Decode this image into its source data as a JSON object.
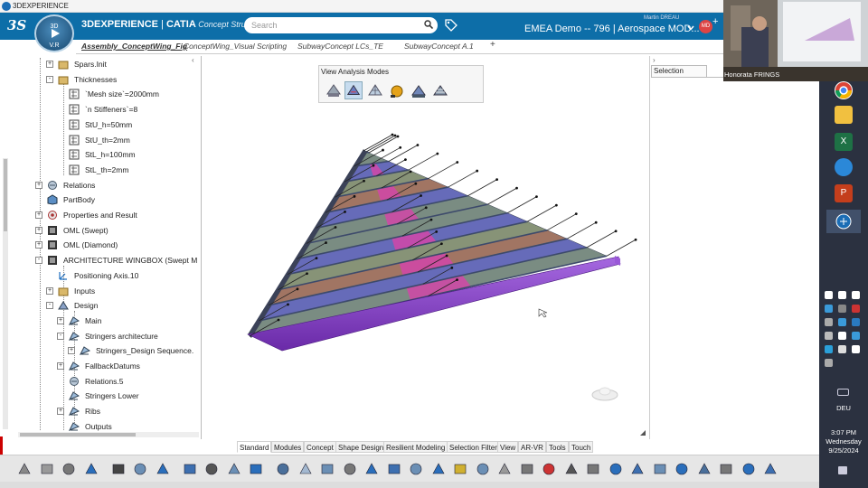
{
  "window": {
    "title": "3DEXPERIENCE"
  },
  "header": {
    "logo": "3S",
    "compass_top": "3D",
    "compass_version": "V.R",
    "app_brand": "3DEXPERIENCE",
    "app_sep": " | ",
    "app_name": "CATIA",
    "app_role": " Concept Struct...",
    "search_placeholder": "Search",
    "user_name": "Martin DREAU",
    "tenant": "EMEA Demo -- 796 | Aerospace MOD...",
    "avatar_initials": "MD"
  },
  "tabs": [
    {
      "label": "Assembly_ConceptWing_Fig",
      "active": true
    },
    {
      "label": "ConceptWing_Visual Scripting",
      "active": false
    },
    {
      "label": "SubwayConcept LCs_TE",
      "active": false
    },
    {
      "label": "SubwayConcept A.1",
      "active": false
    }
  ],
  "tree": [
    {
      "label": "Spars.Init",
      "expander": "+"
    },
    {
      "label": "Thicknesses",
      "expander": "-"
    },
    {
      "label": "`Mesh size`=2000mm",
      "expander": ""
    },
    {
      "label": "`n Stiffeners`=8",
      "expander": ""
    },
    {
      "label": "StU_h=50mm",
      "expander": ""
    },
    {
      "label": "StU_th=2mm",
      "expander": ""
    },
    {
      "label": "StL_h=100mm",
      "expander": ""
    },
    {
      "label": "StL_th=2mm",
      "expander": ""
    },
    {
      "label": "Relations",
      "expander": "+"
    },
    {
      "label": "PartBody",
      "expander": ""
    },
    {
      "label": "Properties and Result",
      "expander": "+"
    },
    {
      "label": "OML (Swept)",
      "expander": "+"
    },
    {
      "label": "OML (Diamond)",
      "expander": "+"
    },
    {
      "label": "ARCHITECTURE WINGBOX (Swept M",
      "expander": "-"
    },
    {
      "label": "Positioning Axis.10",
      "expander": ""
    },
    {
      "label": "Inputs",
      "expander": "+"
    },
    {
      "label": "Design",
      "expander": "-"
    },
    {
      "label": "Main",
      "expander": "+"
    },
    {
      "label": "Stringers architecture",
      "expander": "-"
    },
    {
      "label": "Stringers_Design Sequence.",
      "expander": "+"
    },
    {
      "label": "FallbackDatums",
      "expander": "+"
    },
    {
      "label": "Relations.5",
      "expander": ""
    },
    {
      "label": "Stringers Lower",
      "expander": ""
    },
    {
      "label": "Ribs",
      "expander": "+"
    },
    {
      "label": "Outputs",
      "expander": ""
    }
  ],
  "analysis_panel": {
    "title": "View Analysis Modes",
    "icons": [
      "shaded-icon",
      "analysis-mode-active-icon",
      "mesh-view-icon",
      "sphere-icon",
      "material-view-icon",
      "result-view-icon"
    ]
  },
  "selection_panel": {
    "tab_label": "Selection"
  },
  "action_bar_tabs": [
    {
      "label": "Standard",
      "active": true
    },
    {
      "label": "Modules",
      "active": false
    },
    {
      "label": "Concept",
      "active": false
    },
    {
      "label": "Shape Design",
      "active": false
    },
    {
      "label": "Resilient Modeling",
      "active": false
    },
    {
      "label": "Selection Filter",
      "active": false
    },
    {
      "label": "View",
      "active": false
    },
    {
      "label": "AR-VR",
      "active": false
    },
    {
      "label": "Tools",
      "active": false
    },
    {
      "label": "Touch",
      "active": false
    }
  ],
  "webcam": {
    "name": "Honorata FRINGS"
  },
  "taskbar": {
    "language": "DEU",
    "time": "3:07 PM",
    "day": "Wednesday",
    "date": "9/25/2024"
  },
  "colors": {
    "header": "#0d6ea8",
    "spar": "#8a3fd1",
    "rib_dark": "#3d4a6b",
    "stringer_pink": "#d246a8",
    "panel_gray": "#6f8378",
    "panel_blue": "#5a5fb4",
    "panel_olive": "#7d8a6c",
    "panel_brown": "#9a6a56"
  }
}
